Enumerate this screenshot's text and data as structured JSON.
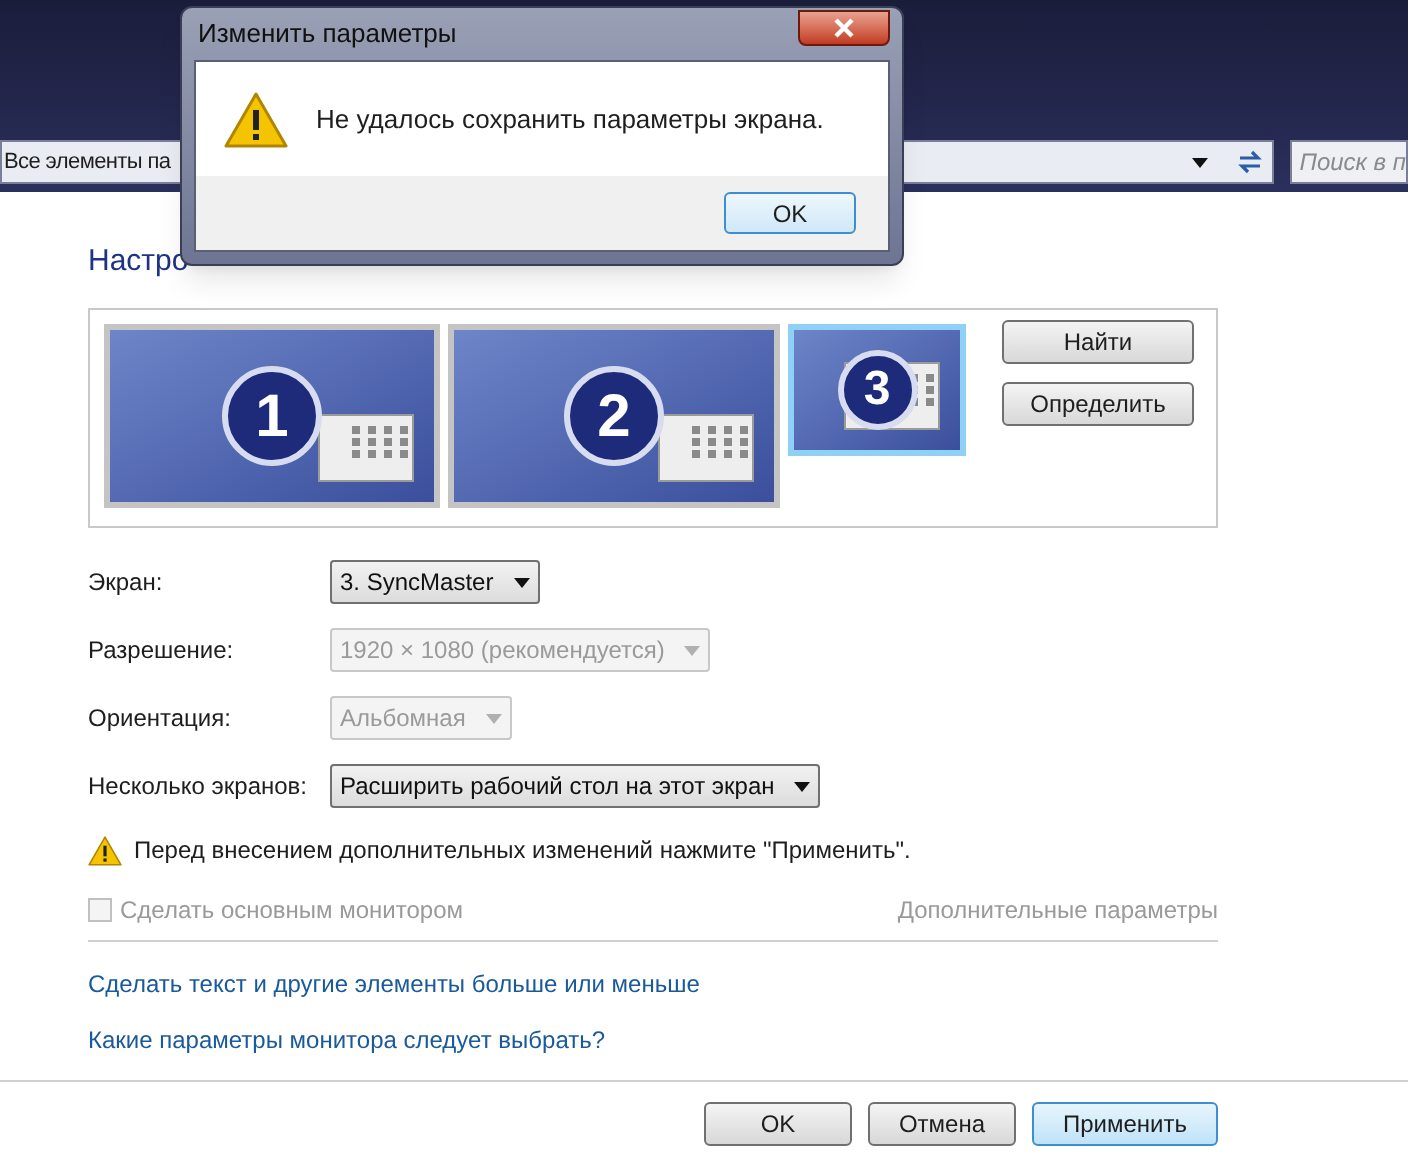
{
  "explorer": {
    "address": "Все элементы па",
    "search_placeholder": "Поиск в п"
  },
  "page": {
    "title": "Настро",
    "monitors": [
      {
        "number": "1",
        "selected": false
      },
      {
        "number": "2",
        "selected": false
      },
      {
        "number": "3",
        "selected": true
      }
    ],
    "side_buttons": [
      "Найти",
      "Определить"
    ],
    "fields": [
      {
        "label": "Экран:",
        "value": "3. SyncMaster",
        "disabled": false
      },
      {
        "label": "Разрешение:",
        "value": "1920 × 1080 (рекомендуется)",
        "disabled": true
      },
      {
        "label": "Ориентация:",
        "value": "Альбомная",
        "disabled": true
      },
      {
        "label": "Несколько экранов:",
        "value": "Расширить рабочий стол на этот экран",
        "disabled": false
      }
    ],
    "warning": "Перед внесением дополнительных изменений нажмите \"Применить\".",
    "primary_checkbox": {
      "label": "Сделать основным монитором",
      "checked": false,
      "disabled": true
    },
    "advanced_link": "Дополнительные параметры",
    "links": [
      "Сделать текст и другие элементы больше или меньше",
      "Какие параметры монитора следует выбрать?"
    ],
    "buttons": [
      {
        "label": "OK",
        "default": false
      },
      {
        "label": "Отмена",
        "default": false
      },
      {
        "label": "Применить",
        "default": true
      }
    ]
  },
  "dialog": {
    "title": "Изменить параметры",
    "message": "Не удалось сохранить параметры экрана.",
    "button": "OK"
  }
}
